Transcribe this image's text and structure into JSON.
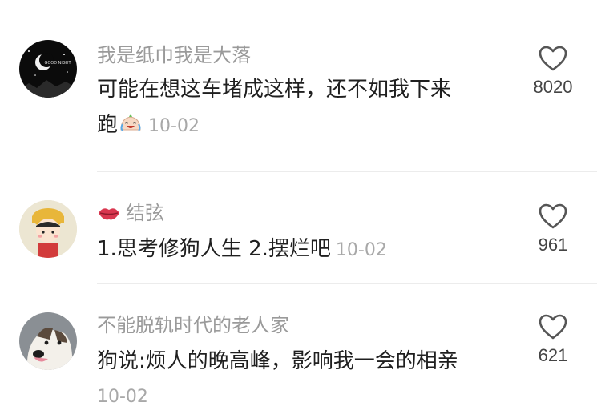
{
  "comments": [
    {
      "username": "我是纸巾我是大落",
      "text_line1": "可能在想这车堵成这样，还不如我下来",
      "text_line2": "跑",
      "date": "10-02",
      "likes": "8020",
      "avatar_text": "GOOD NIGHT"
    },
    {
      "username": "结弦",
      "text": "1.思考修狗人生 2.摆烂吧",
      "date": "10-02",
      "likes": "961"
    },
    {
      "username": "不能脱轨时代的老人家",
      "text": "狗说:烦人的晚高峰，影响我一会的相亲",
      "date": "10-02",
      "likes": "621"
    }
  ],
  "icons": {
    "like": "heart-outline-icon",
    "emoji": "crying-laughing-face-icon",
    "badge": "lips-icon"
  },
  "colors": {
    "username": "#9a9a9a",
    "text": "#1f1f1f",
    "date": "#a8a8a8",
    "badge": "#d9364f"
  }
}
